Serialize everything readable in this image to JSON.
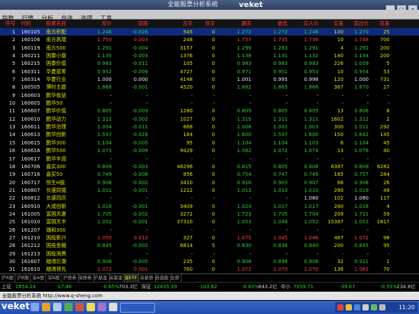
{
  "window": {
    "title": "全能股票分析系统",
    "brand": "veket"
  },
  "menu": [
    "指数",
    "行情",
    "分析",
    "自选",
    "选项",
    "工具"
  ],
  "columns": [
    "序号",
    "代码",
    "股票名称",
    "现价",
    "涨跌",
    "总手",
    "现手",
    "最高",
    "最低",
    "买入价",
    "买量",
    "卖出价",
    "卖量",
    "涨跌幅度",
    "今开盘",
    "前收盘"
  ],
  "rows": [
    {
      "n": "1",
      "code": "160105",
      "name": "南方积配",
      "price": "1.246",
      "chg": "-0.026",
      "vol": "545",
      "cur": "0",
      "high": "1.272",
      "low": "1.272",
      "bid": "1.246",
      "bv": "100",
      "ask": "1.270",
      "av": "25",
      "pct": "-2.044",
      "open": "1.272",
      "prev": "1.272",
      "dir": "down"
    },
    {
      "n": "2",
      "code": "160106",
      "name": "南方高增",
      "price": "1.750",
      "chg": "0.003",
      "vol": "248",
      "cur": "0",
      "high": "1.757",
      "low": "1.735",
      "bid": "1.736",
      "bv": "10",
      "ask": "1.748",
      "av": "700",
      "pct": "0.172",
      "open": "1.735",
      "prev": "1.747",
      "dir": "up"
    },
    {
      "n": "3",
      "code": "160119",
      "name": "南方500",
      "price": "1.291",
      "chg": "-0.004",
      "vol": "3157",
      "cur": "0",
      "high": "1.299",
      "low": "1.283",
      "bid": "1.291",
      "bv": "4",
      "ask": "1.292",
      "av": "200",
      "pct": "-0.309",
      "open": "1.295",
      "prev": "1.295",
      "dir": "down"
    },
    {
      "n": "4",
      "code": "160211",
      "name": "国泰小盘",
      "price": "1.135",
      "chg": "-0.003",
      "vol": "1376",
      "cur": "0",
      "high": "1.138",
      "low": "1.131",
      "bid": "1.132",
      "bv": "180",
      "ask": "1.134",
      "av": "200",
      "pct": "-0.264",
      "open": "1.136",
      "prev": "1.138",
      "dir": "down"
    },
    {
      "n": "5",
      "code": "160215",
      "name": "国泰价值",
      "price": "0.983",
      "chg": "-0.011",
      "vol": "105",
      "cur": "0",
      "high": "0.983",
      "low": "0.983",
      "bid": "0.983",
      "bv": "226",
      "ask": "1.009",
      "av": "5",
      "pct": "-1.107",
      "open": "0.983",
      "prev": "0.994",
      "dir": "down"
    },
    {
      "n": "6",
      "code": "160311",
      "name": "华夏蓝筹",
      "price": "0.952",
      "chg": "-0.009",
      "vol": "4727",
      "cur": "0",
      "high": "0.971",
      "low": "0.951",
      "bid": "0.953",
      "bv": "10",
      "ask": "0.954",
      "av": "53",
      "pct": "-0.937",
      "open": "0.961",
      "prev": "0.961",
      "dir": "down"
    },
    {
      "n": "7",
      "code": "160314",
      "name": "华夏行业",
      "price": "1.000",
      "chg": "0.000",
      "vol": "4148",
      "cur": "0",
      "high": "1.001",
      "low": "0.995",
      "bid": "0.998",
      "bv": "120",
      "ask": "1.000",
      "av": "731",
      "pct": "0.000",
      "open": "0.997",
      "prev": "1.000",
      "dir": "flat"
    },
    {
      "n": "8",
      "code": "160505",
      "name": "博时主题",
      "price": "1.868",
      "chg": "-0.001",
      "vol": "4520",
      "cur": "0",
      "high": "1.882",
      "low": "1.865",
      "bid": "1.868",
      "bv": "367",
      "ask": "1.870",
      "av": "27",
      "pct": "-0.054",
      "open": "1.869",
      "prev": "1.869",
      "dir": "down"
    },
    {
      "n": "9",
      "code": "160603",
      "name": "鹏华收益",
      "price": "-",
      "chg": "-",
      "vol": "-",
      "cur": "-",
      "high": "-",
      "low": "-",
      "bid": "-",
      "bv": "-",
      "ask": "-",
      "av": "-",
      "pct": "-",
      "open": "-",
      "prev": "-",
      "dir": "none"
    },
    {
      "n": "10",
      "code": "160605",
      "name": "鹏华50",
      "price": "-",
      "chg": "-",
      "vol": "-",
      "cur": "-",
      "high": "-",
      "low": "-",
      "bid": "-",
      "bv": "-",
      "ask": "-",
      "av": "-",
      "pct": "-",
      "open": "-",
      "prev": "-",
      "dir": "none"
    },
    {
      "n": "11",
      "code": "160607",
      "name": "鹏华价值",
      "price": "0.805",
      "chg": "-0.009",
      "vol": "1280",
      "cur": "0",
      "high": "0.809",
      "low": "0.805",
      "bid": "0.805",
      "bv": "13",
      "ask": "0.806",
      "av": "8",
      "pct": "-1.106",
      "open": "0.806",
      "prev": "0.814",
      "dir": "down"
    },
    {
      "n": "12",
      "code": "160610",
      "name": "鹏华动力",
      "price": "1.312",
      "chg": "-0.002",
      "vol": "1027",
      "cur": "0",
      "high": "1.315",
      "low": "1.311",
      "bid": "1.311",
      "bv": "1602",
      "ask": "1.312",
      "av": "2",
      "pct": "-0.152",
      "open": "1.315",
      "prev": "1.314",
      "dir": "down"
    },
    {
      "n": "13",
      "code": "160611",
      "name": "鹏华治理",
      "price": "1.004",
      "chg": "-0.011",
      "vol": "868",
      "cur": "0",
      "high": "1.008",
      "low": "1.002",
      "bid": "1.003",
      "bv": "300",
      "ask": "1.011",
      "av": "292",
      "pct": "-1.084",
      "open": "1.002",
      "prev": "1.015",
      "dir": "down"
    },
    {
      "n": "14",
      "code": "160613",
      "name": "鹏华创新",
      "price": "1.597",
      "chg": "-0.028",
      "vol": "164",
      "cur": "0",
      "high": "1.600",
      "low": "1.597",
      "bid": "1.600",
      "bv": "150",
      "ask": "1.642",
      "av": "145",
      "pct": "-1.723",
      "open": "1.600",
      "prev": "1.625",
      "dir": "down"
    },
    {
      "n": "15",
      "code": "160615",
      "name": "鹏华300",
      "price": "1.104",
      "chg": "-0.005",
      "vol": "95",
      "cur": "0",
      "high": "1.104",
      "low": "1.104",
      "bid": "1.103",
      "bv": "6",
      "ask": "1.104",
      "av": "45",
      "pct": "-0.451",
      "open": "1.104",
      "prev": "1.109",
      "dir": "down"
    },
    {
      "n": "16",
      "code": "160616",
      "name": "鹏华500",
      "price": "1.073",
      "chg": "-0.009",
      "vol": "9429",
      "cur": "0",
      "high": "1.082",
      "low": "1.072",
      "bid": "1.074",
      "bv": "13",
      "ask": "1.076",
      "av": "40",
      "pct": "-0.832",
      "open": "1.082",
      "prev": "1.082",
      "dir": "down"
    },
    {
      "n": "17",
      "code": "160617",
      "name": "鹏华丰润",
      "price": "-",
      "chg": "-",
      "vol": "-",
      "cur": "-",
      "high": "-",
      "low": "-",
      "bid": "-",
      "bv": "-",
      "ask": "-",
      "av": "-",
      "pct": "-",
      "open": "-",
      "prev": "-",
      "dir": "none"
    },
    {
      "n": "18",
      "code": "160706",
      "name": "嘉实300",
      "price": "0.809",
      "chg": "-0.003",
      "vol": "46296",
      "cur": "0",
      "high": "0.815",
      "low": "0.805",
      "bid": "0.808",
      "bv": "6387",
      "ask": "0.809",
      "av": "6282",
      "pct": "-0.369",
      "open": "0.809",
      "prev": "0.812",
      "dir": "down"
    },
    {
      "n": "19",
      "code": "160716",
      "name": "嘉实50",
      "price": "0.749",
      "chg": "-0.008",
      "vol": "856",
      "cur": "0",
      "high": "0.754",
      "low": "0.747",
      "bid": "0.749",
      "bv": "165",
      "ask": "0.757",
      "av": "284",
      "pct": "-1.057",
      "open": "0.754",
      "prev": "0.757",
      "dir": "down"
    },
    {
      "n": "20",
      "code": "160717",
      "name": "恒生H股",
      "price": "0.908",
      "chg": "-0.002",
      "vol": "3410",
      "cur": "0",
      "high": "0.916",
      "low": "0.903",
      "bid": "0.907",
      "bv": "66",
      "ask": "0.908",
      "av": "26",
      "pct": "-0.220",
      "open": "0.905",
      "prev": "0.910",
      "dir": "down"
    },
    {
      "n": "21",
      "code": "160807",
      "name": "长盛同德",
      "price": "1.011",
      "chg": "-0.001",
      "vol": "1212",
      "cur": "0",
      "high": "1.013",
      "low": "1.010",
      "bid": "1.010",
      "bv": "280",
      "ask": "1.019",
      "av": "49",
      "pct": "-0.099",
      "open": "1.010",
      "prev": "1.012",
      "dir": "down"
    },
    {
      "n": "22",
      "code": "160812",
      "name": "长盛同庆",
      "price": "-",
      "chg": "-",
      "vol": "-",
      "cur": "-",
      "high": "-",
      "low": "-",
      "bid": "1.080",
      "bv": "102",
      "ask": "1.080",
      "av": "117",
      "pct": "-",
      "open": "-",
      "prev": "1.080",
      "dir": "none"
    },
    {
      "n": "23",
      "code": "160910",
      "name": "大成创新",
      "price": "1.018",
      "chg": "-0.001",
      "vol": "3409",
      "cur": "0",
      "high": "1.024",
      "low": "1.017",
      "bid": "1.017",
      "bv": "280",
      "ask": "1.018",
      "av": "4",
      "pct": "-0.098",
      "open": "1.017",
      "prev": "1.017",
      "dir": "down"
    },
    {
      "n": "24",
      "code": "161005",
      "name": "富国天惠",
      "price": "1.705",
      "chg": "-0.002",
      "vol": "3272",
      "cur": "0",
      "high": "1.723",
      "low": "1.705",
      "bid": "1.704",
      "bv": "209",
      "ask": "1.711",
      "av": "59",
      "pct": "-0.117",
      "open": "1.713",
      "prev": "1.703",
      "dir": "down"
    },
    {
      "n": "25",
      "code": "161010",
      "name": "富国天丰",
      "price": "1.052",
      "chg": "-0.001",
      "vol": "37310",
      "cur": "0",
      "high": "1.053",
      "low": "1.048",
      "bid": "1.052",
      "bv": "15387",
      "ask": "1.053",
      "av": "1817",
      "pct": "-0.095",
      "open": "1.053",
      "prev": "1.053",
      "dir": "down"
    },
    {
      "n": "26",
      "code": "161207",
      "name": "瑞和300",
      "price": "-",
      "chg": "-",
      "vol": "-",
      "cur": "-",
      "high": "-",
      "low": "-",
      "bid": "-",
      "bv": "-",
      "ask": "-",
      "av": "-",
      "pct": "-",
      "open": "-",
      "prev": "-",
      "dir": "none"
    },
    {
      "n": "27",
      "code": "161210",
      "name": "国投新兴",
      "price": "1.050",
      "chg": "0.012",
      "vol": "327",
      "cur": "0",
      "high": "1.075",
      "low": "1.045",
      "bid": "1.046",
      "bv": "467",
      "ask": "1.072",
      "av": "98",
      "pct": "1.130",
      "open": "1.050",
      "prev": "1.062",
      "dir": "up"
    },
    {
      "n": "28",
      "code": "161212",
      "name": "国投金融",
      "price": "0.845",
      "chg": "-0.002",
      "vol": "6814",
      "cur": "5",
      "high": "0.830",
      "low": "0.836",
      "bid": "0.840",
      "bv": "200",
      "ask": "0.845",
      "av": "95",
      "pct": "-0.237",
      "open": "0.839",
      "prev": "0.843",
      "dir": "down"
    },
    {
      "n": "29",
      "code": "161213",
      "name": "国投消费",
      "price": "-",
      "chg": "-",
      "vol": "-",
      "cur": "-",
      "high": "-",
      "low": "-",
      "bid": "-",
      "bv": "-",
      "ask": "-",
      "av": "-",
      "pct": "-",
      "open": "-",
      "prev": "-",
      "dir": "none"
    },
    {
      "n": "30",
      "code": "161607",
      "name": "融通巨潮",
      "price": "0.908",
      "chg": "-0.005",
      "vol": "235",
      "cur": "0",
      "high": "0.908",
      "low": "0.898",
      "bid": "0.906",
      "bv": "32",
      "ask": "0.911",
      "av": "1",
      "pct": "-0.549",
      "open": "0.898",
      "prev": "0.911",
      "dir": "down"
    },
    {
      "n": "31",
      "code": "161610",
      "name": "融通领先",
      "price": "1.072",
      "chg": "0.001",
      "vol": "760",
      "cur": "0",
      "high": "1.072",
      "low": "1.070",
      "bid": "1.070",
      "bv": "136",
      "ask": "1.082",
      "av": "70",
      "pct": "0.093",
      "open": "1.071",
      "prev": "1.071",
      "dir": "up"
    }
  ],
  "tabs": [
    "沪A股",
    "沪B股",
    "深A股",
    "深B股",
    "沪债券",
    "深债券",
    "沪基金",
    "深基金",
    "深ETF",
    "深基债",
    "自选股",
    "全部"
  ],
  "active_tab": 8,
  "indices": [
    {
      "name": "上证",
      "value": "2654.24",
      "chg": "-17.46",
      "pct": "-0.65%",
      "amt": "703.3亿"
    },
    {
      "name": "深证",
      "value": "12435.39",
      "chg": "-103.62",
      "pct": "-0.83%",
      "amt": "843.2亿"
    },
    {
      "name": "中小",
      "value": "7059.71",
      "chg": "-39.07",
      "pct": "-0.55%",
      "amt": "234.8亿"
    }
  ],
  "urlbar": "全能股票分析系统 http://www.q-sheng.com",
  "taskbar": {
    "logo": "veket",
    "clock": "11:20"
  },
  "colors": {
    "up": "#ff4040",
    "down": "#30d030",
    "flat": "#e8e8e8",
    "code": "#e0e000",
    "name": "#e0e000",
    "title_bg": "#2e3f60"
  }
}
